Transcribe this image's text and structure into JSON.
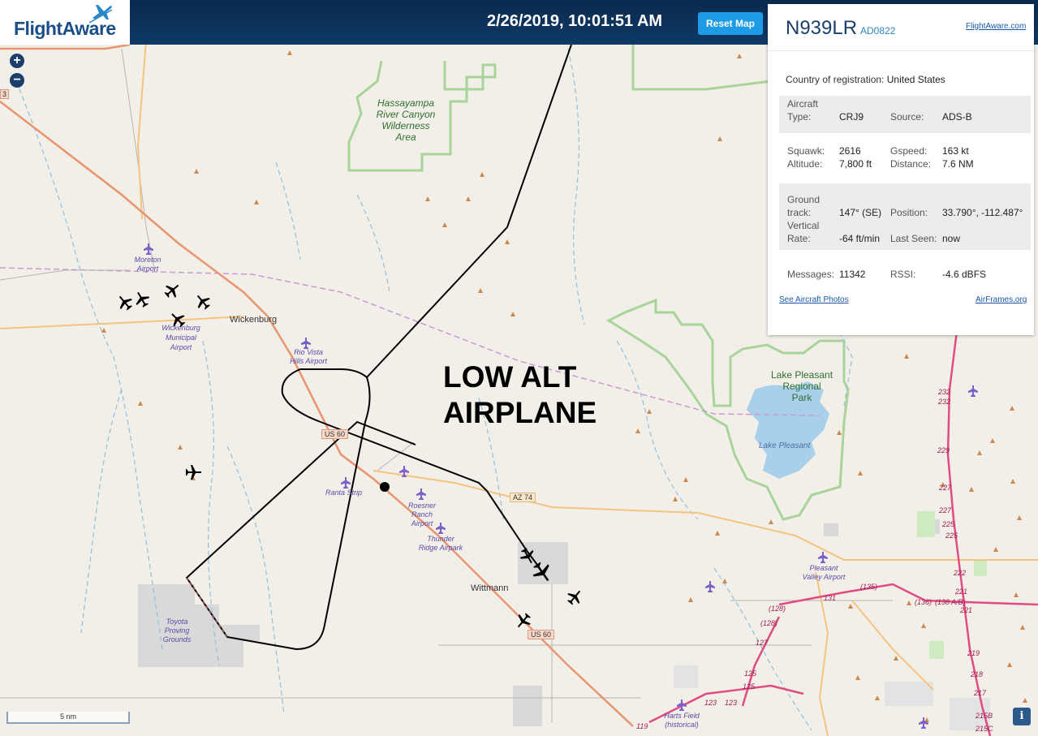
{
  "header": {
    "logo": "FlightAware",
    "timestamp": "2/26/2019, 10:01:51 AM",
    "reset_label": "Reset Map"
  },
  "map": {
    "zoom_in": "+",
    "zoom_out": "−",
    "annotation_line1": "LOW ALT",
    "annotation_line2": "AIRPLANE",
    "scale_label": "5 nm",
    "info_label": "i",
    "labels": {
      "hassayampa": [
        "Hassayampa",
        "River Canyon",
        "Wilderness",
        "Area"
      ],
      "lake_pleasant_park": [
        "Lake Pleasant",
        "Regional",
        "Park"
      ],
      "lake_pleasant": "Lake Pleasant",
      "moreton": [
        "Moreton",
        "Airport"
      ],
      "wickenburg_airport": [
        "Wickenburg",
        "Municipal",
        "Airport"
      ],
      "wickenburg": "Wickenburg",
      "rio_vista": [
        "Rio Vista",
        "Hills Airport"
      ],
      "ranta": "Ranta Strip",
      "roesner": [
        "Roesner",
        "Ranch",
        "Airport"
      ],
      "thunder_ridge": [
        "Thunder",
        "Ridge Airpark"
      ],
      "wittmann": "Wittmann",
      "toyota": [
        "Toyota",
        "Proving",
        "Grounds"
      ],
      "pleasant_valley": [
        "Pleasant",
        "Valley Airport"
      ],
      "harts": [
        "Harts Field",
        "(historical)"
      ],
      "us60_a": "US 60",
      "us60_b": "US 60",
      "az74": "AZ 74",
      "route_left": "3",
      "road_numbers": [
        "232",
        "232",
        "229",
        "227",
        "227",
        "225",
        "225",
        "222",
        "221",
        "221",
        "219",
        "218",
        "217",
        "215B",
        "215C",
        "131",
        "(135)",
        "(136)",
        "(138 A/B)",
        "(128)",
        "(128)",
        "127",
        "125",
        "125",
        "123",
        "123",
        "119"
      ]
    }
  },
  "panel": {
    "registration": "N939LR",
    "flight_id": "AD0822",
    "fa_link": "FlightAware.com",
    "country_label": "Country of registration:",
    "country_value": "United States",
    "aircraft_type_label_1": "Aircraft",
    "aircraft_type_label_2": "Type:",
    "aircraft_type": "CRJ9",
    "source_label": "Source:",
    "source": "ADS-B",
    "squawk_label": "Squawk:",
    "squawk": "2616",
    "gspeed_label": "Gspeed:",
    "gspeed": "163 kt",
    "altitude_label": "Altitude:",
    "altitude": "7,800 ft",
    "distance_label": "Distance:",
    "distance": "7.6 NM",
    "ground_track_label_1": "Ground",
    "ground_track_label_2": "track:",
    "ground_track": "147° (SE)",
    "position_label": "Position:",
    "position": "33.790°, -112.487°",
    "vertical_rate_label_1": "Vertical",
    "vertical_rate_label_2": "Rate:",
    "vertical_rate": "-64 ft/min",
    "last_seen_label": "Last Seen:",
    "last_seen": "now",
    "messages_label": "Messages:",
    "messages": "11342",
    "rssi_label": "RSSI:",
    "rssi": "-4.6 dBFS",
    "photos_link": "See Aircraft Photos",
    "airframes_link": "AirFrames.org"
  },
  "colors": {
    "header_bg": "#0f3a66",
    "reset_button": "#1e9be6",
    "map_land": "#f2efe9",
    "park_border": "#a8d49a",
    "lake": "#a9d0ea",
    "highway": "#e8956f",
    "road": "#f4c37e",
    "boundary": "#c79ad6",
    "track": "#000000"
  }
}
